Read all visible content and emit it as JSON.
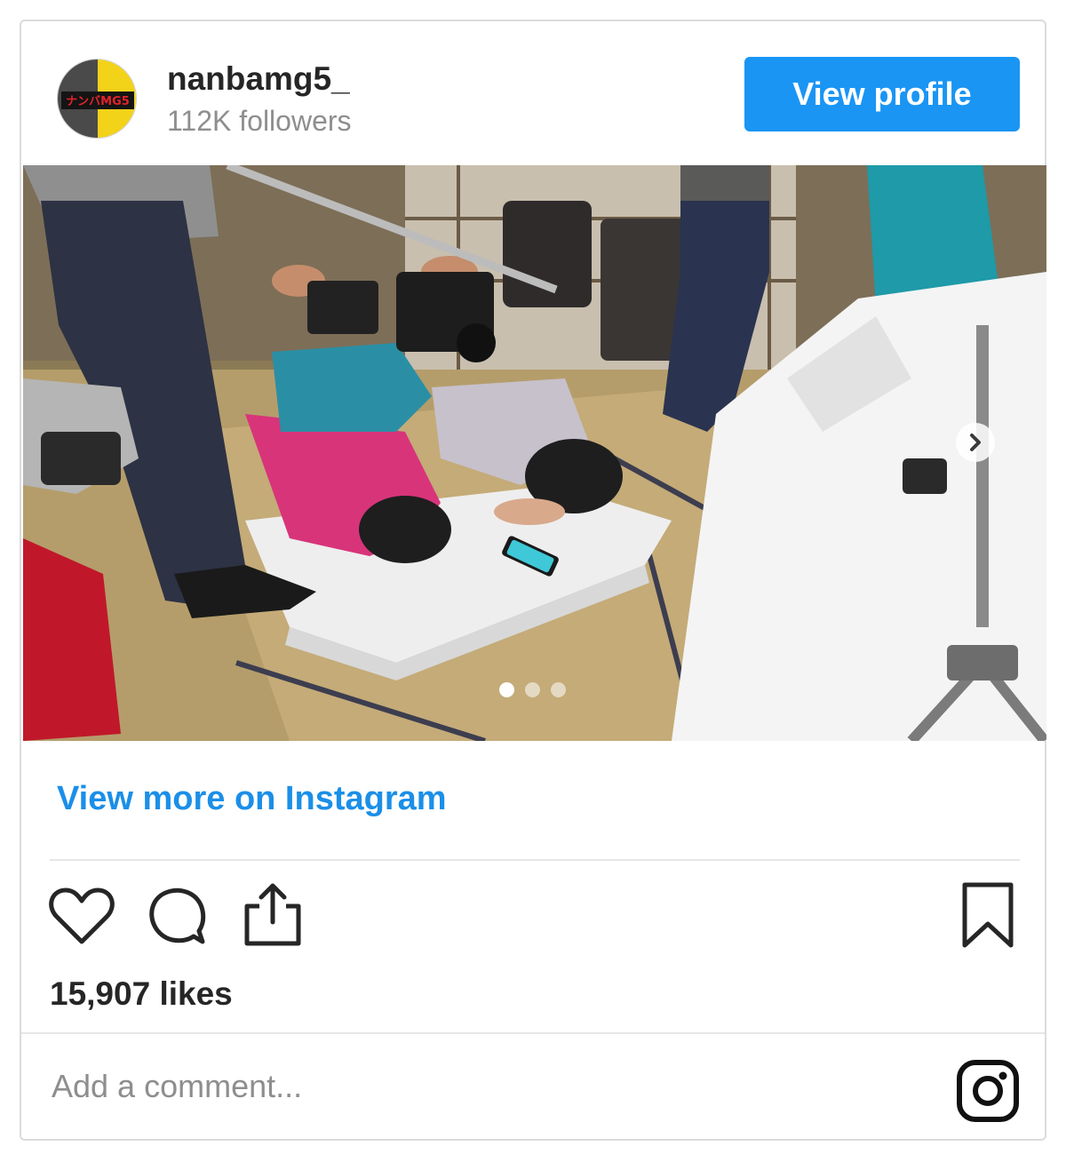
{
  "account": {
    "username": "nanbamg5_",
    "followers": "112K followers",
    "avatar_text": "ナンバMG5"
  },
  "header": {
    "view_profile_label": "View profile"
  },
  "carousel": {
    "slide_count": 3,
    "active_index": 0
  },
  "links": {
    "view_more_label": "View more on Instagram"
  },
  "actions": {
    "like_icon": "heart-icon",
    "comment_icon": "comment-icon",
    "share_icon": "share-icon",
    "save_icon": "bookmark-icon"
  },
  "stats": {
    "likes": "15,907 likes"
  },
  "comment": {
    "placeholder": "Add a comment..."
  },
  "colors": {
    "accent": "#1a95f4",
    "link": "#1b8fe8",
    "text": "#262626",
    "muted": "#8e8e8e"
  }
}
